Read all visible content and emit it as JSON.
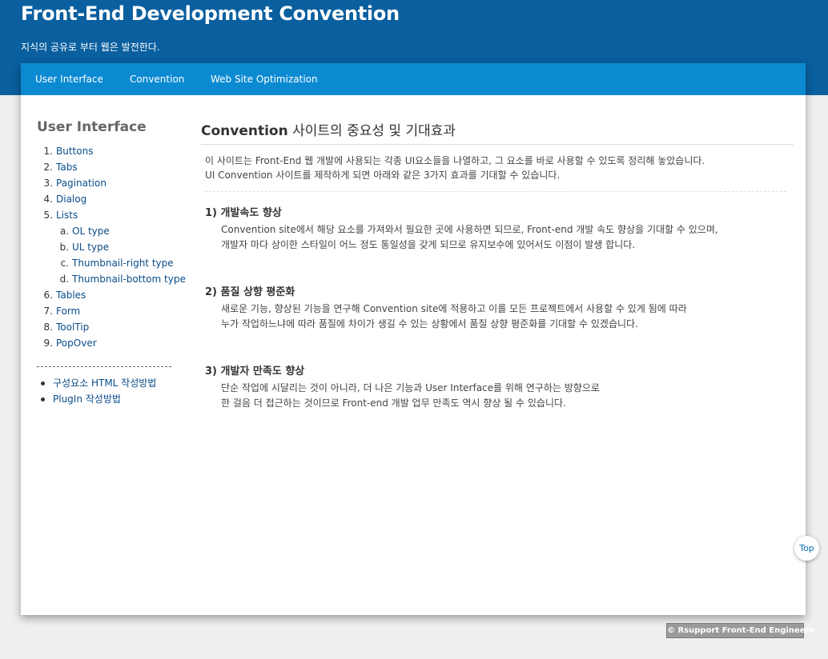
{
  "header": {
    "title": "Front-End Development Convention",
    "subtitle": "지식의 공유로 부터 웹은 발전한다."
  },
  "nav": {
    "items": [
      "User Interface",
      "Convention",
      "Web Site Optimization"
    ]
  },
  "sidebar": {
    "title": "User Interface",
    "items": [
      {
        "num": "1.",
        "label": "Buttons"
      },
      {
        "num": "2.",
        "label": "Tabs"
      },
      {
        "num": "3.",
        "label": "Pagination"
      },
      {
        "num": "4.",
        "label": "Dialog"
      },
      {
        "num": "5.",
        "label": "Lists"
      },
      {
        "num": "a.",
        "label": "OL type"
      },
      {
        "num": "b.",
        "label": "UL type"
      },
      {
        "num": "c.",
        "label": "Thumbnail-right type"
      },
      {
        "num": "d.",
        "label": "Thumbnail-bottom type"
      },
      {
        "num": "6.",
        "label": "Tables"
      },
      {
        "num": "7.",
        "label": "Form"
      },
      {
        "num": "8.",
        "label": "ToolTip"
      },
      {
        "num": "9.",
        "label": "PopOver"
      }
    ],
    "links": [
      "구성요소 HTML 작성방법",
      "PlugIn 작성방법"
    ]
  },
  "content": {
    "title_bold": "Convention",
    "title_rest": " 사이트의 중요성 및 기대효과",
    "intro": [
      "이 사이트는 Front-End 웹 개발에 사용되는 각종 UI요소들을 나열하고, 그 요소를 바로 사용할 수 있도록 정리해 놓았습니다.",
      "UI Convention 사이트를 제작하게 되면 아래와 같은 3가지 효과를 기대할 수 있습니다."
    ],
    "sections": [
      {
        "title": "1) 개발속도 향상",
        "lines": [
          "Convention site에서 해당 요소를 가져와서 필요한 곳에 사용하면 되므로, Front-end 개발 속도 향상을 기대할 수 있으며,",
          "개발자 마다 상이한 스타일이 어느 정도 통일성을 갖게 되므로 유지보수에 있어서도 이점이 발생 합니다."
        ]
      },
      {
        "title": "2) 품질 상향 평준화",
        "lines": [
          "새로운 기능, 향상된 기능을 연구해 Convention site에 적용하고 이를 모든 프로젝트에서 사용할 수 있게 됨에 따라",
          "누가 작업하느냐에 따라 품질에 차이가 생길 수 있는 상황에서 품질 상향 평준화를 기대할 수 있겠습니다."
        ]
      },
      {
        "title": "3) 개발자 만족도 향상",
        "lines": [
          "단순 작업에 시달리는 것이 아니라, 더 나은 기능과 User Interface를 위해 연구하는 방향으로",
          "한 걸음 더 접근하는 것이므로 Front-end 개발 업무 만족도 역시 향상 될 수 있습니다."
        ]
      }
    ]
  },
  "top_button": "Top",
  "footer": "© Rsupport Front-End Engineers",
  "colors": {
    "header_bg": "#0a5f9f",
    "nav_bg": "#0b8ad2",
    "link": "#0a4d8a"
  }
}
